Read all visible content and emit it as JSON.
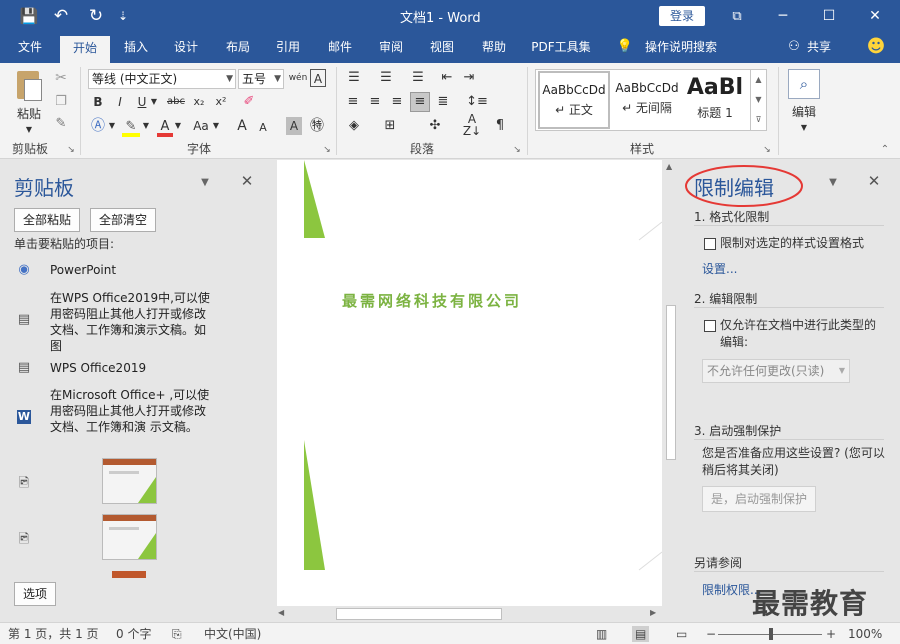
{
  "titlebar": {
    "title": "文档1  -  Word",
    "login": "登录",
    "restore_glyph": "⧉",
    "minimize_glyph": "─",
    "maximize_glyph": "☐",
    "close_glyph": "✕",
    "save_glyph": "💾",
    "undo_glyph": "↶",
    "redo_glyph": "↻",
    "qat_glyph": "⇣"
  },
  "tabs": [
    "文件",
    "开始",
    "插入",
    "设计",
    "布局",
    "引用",
    "邮件",
    "审阅",
    "视图",
    "帮助",
    "PDF工具集",
    "操作说明搜索"
  ],
  "tab_extra": {
    "share": "共享",
    "lightbulb": "💡",
    "smiley": "☻"
  },
  "ribbon": {
    "clipboard": {
      "paste": "粘贴",
      "label": "剪贴板"
    },
    "font": {
      "name": "等线 (中文正文)",
      "size": "五号",
      "label": "字体",
      "bold": "B",
      "italic": "I",
      "underline": "U",
      "strike": "abc",
      "sub": "x₂",
      "sup": "x²",
      "grow": "A",
      "shrink": "A",
      "aa": "Aa"
    },
    "paragraph": {
      "label": "段落"
    },
    "styles": {
      "label": "样式",
      "items": [
        {
          "sample": "AaBbCcDd",
          "name": "↵ 正文"
        },
        {
          "sample": "AaBbCcDd",
          "name": "↵ 无间隔"
        },
        {
          "sample": "AaBl",
          "name": "标题 1"
        }
      ]
    },
    "editing": {
      "label": "编辑"
    }
  },
  "clipboard_pane": {
    "title": "剪贴板",
    "paste_all": "全部粘贴",
    "clear_all": "全部清空",
    "hint": "单击要粘贴的项目:",
    "items": [
      {
        "icon": "◉",
        "text": "PowerPoint"
      },
      {
        "icon": "▤",
        "text": "在WPS Office2019中,可以使用密码阻止其他人打开或修改文档、工作簿和演示文稿。如图"
      },
      {
        "icon": "▤",
        "text": "WPS Office2019"
      },
      {
        "icon": "W",
        "text": "在Microsoft Office+ ,可以使用密码阻止其他人打开或修改文档、工作簿和演 示文稿。"
      }
    ],
    "options": "选项"
  },
  "document": {
    "text": "最需网络科技有限公司"
  },
  "restrict_pane": {
    "title": "限制编辑",
    "s1_heading": "1. 格式化限制",
    "s1_check": "限制对选定的样式设置格式",
    "s1_link": "设置...",
    "s2_heading": "2. 编辑限制",
    "s2_check": "仅允许在文档中进行此类型的编辑:",
    "s2_select": "不允许任何更改(只读)",
    "s3_heading": "3. 启动强制保护",
    "s3_text": "您是否准备应用这些设置? (您可以稍后将其关闭)",
    "s3_button": "是，启动强制保护",
    "see_also": "另请参阅",
    "see_link": "限制权限..."
  },
  "watermark": "最需教育",
  "statusbar": {
    "page": "第 1 页，共 1 页",
    "words": "0 个字",
    "lang": "中文(中国)",
    "zoom": "100%",
    "zoom_minus": "−",
    "zoom_plus": "+"
  },
  "colors": {
    "brand": "#2b579a",
    "accent_green": "#8cc63f",
    "doc_text": "#7cb342",
    "highlight_circle": "#e53935"
  }
}
